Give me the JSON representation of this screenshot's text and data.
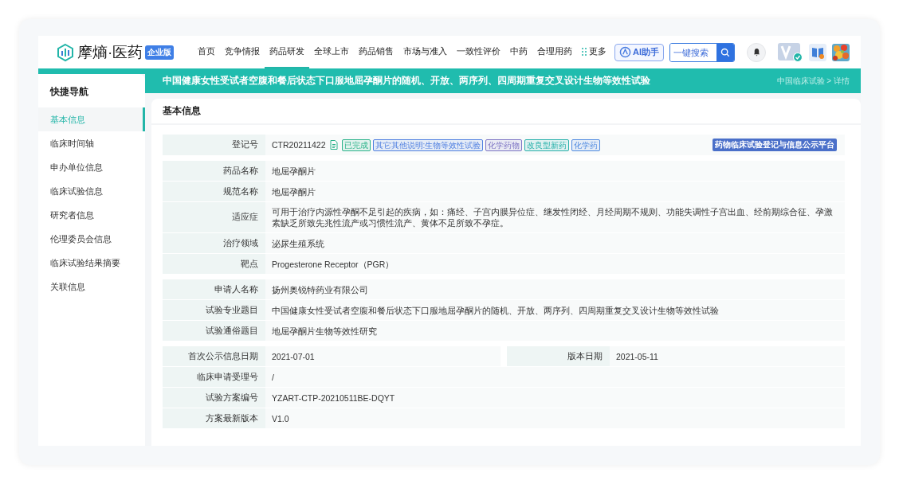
{
  "brand": {
    "name": "摩熵·医药",
    "badge": "企业版"
  },
  "nav": [
    {
      "label": "首页",
      "selected": false
    },
    {
      "label": "竞争情报",
      "selected": false
    },
    {
      "label": "药品研发",
      "selected": true
    },
    {
      "label": "全球上市",
      "selected": false
    },
    {
      "label": "药品销售",
      "selected": false
    },
    {
      "label": "市场与准入",
      "selected": false
    },
    {
      "label": "一致性评价",
      "selected": false
    },
    {
      "label": "中药",
      "selected": false
    },
    {
      "label": "合理用药",
      "selected": false
    }
  ],
  "more": "更多",
  "ai_button": "AI助手",
  "search": {
    "placeholder": "一键搜索"
  },
  "page_title": "中国健康女性受试者空腹和餐后状态下口服地屈孕酮片的随机、开放、两序列、四周期重复交叉设计生物等效性试验",
  "breadcrumb": "中国临床试验 > 详情",
  "sidebar": {
    "title": "快捷导航",
    "items": [
      {
        "label": "基本信息",
        "selected": true
      },
      {
        "label": "临床时间轴",
        "selected": false
      },
      {
        "label": "申办单位信息",
        "selected": false
      },
      {
        "label": "临床试验信息",
        "selected": false
      },
      {
        "label": "研究者信息",
        "selected": false
      },
      {
        "label": "伦理委员会信息",
        "selected": false
      },
      {
        "label": "临床试验结果摘要",
        "selected": false
      },
      {
        "label": "关联信息",
        "selected": false
      }
    ]
  },
  "section_title": "基本信息",
  "registration": {
    "label": "登记号",
    "value": "CTR20211422",
    "source": "药物临床试验登记与信息公示平台",
    "tags": [
      {
        "label": "已完成",
        "color": "#2bb38a"
      },
      {
        "label": "其它其他说明:生物等效性试验",
        "color": "#4f7fe0"
      },
      {
        "label": "化学药物",
        "color": "#7d74c4"
      },
      {
        "label": "改良型新药",
        "color": "#26b0aa"
      },
      {
        "label": "化学药",
        "color": "#4f8ae0"
      }
    ]
  },
  "groups": [
    [
      {
        "label": "药品名称",
        "value": "地屈孕酮片"
      },
      {
        "label": "规范名称",
        "value": "地屈孕酮片"
      },
      {
        "label": "适应症",
        "value": "可用于治疗内源性孕酮不足引起的疾病，如：痛经、子宫内膜异位症、继发性闭经、月经周期不规则、功能失调性子宫出血、经前期综合征、孕激素缺乏所致先兆性流产或习惯性流产、黄体不足所致不孕症。"
      },
      {
        "label": "治疗领域",
        "value": "泌尿生殖系统"
      },
      {
        "label": "靶点",
        "value": "Progesterone Receptor（PGR）"
      }
    ],
    [
      {
        "label": "申请人名称",
        "value": "扬州奥锐特药业有限公司"
      },
      {
        "label": "试验专业题目",
        "value": "中国健康女性受试者空腹和餐后状态下口服地屈孕酮片的随机、开放、两序列、四周期重复交叉设计生物等效性试验"
      },
      {
        "label": "试验通俗题目",
        "value": "地屈孕酮片生物等效性研究"
      }
    ],
    [
      {
        "label": "首次公示信息日期",
        "value": "2021-07-01",
        "label_2": "版本日期",
        "value_2": "2021-05-11"
      },
      {
        "label": "临床申请受理号",
        "value": "/"
      },
      {
        "label": "试验方案编号",
        "value": "YZART-CTP-20210511BE-DQYT"
      },
      {
        "label": "方案最新版本",
        "value": "V1.0"
      }
    ]
  ]
}
